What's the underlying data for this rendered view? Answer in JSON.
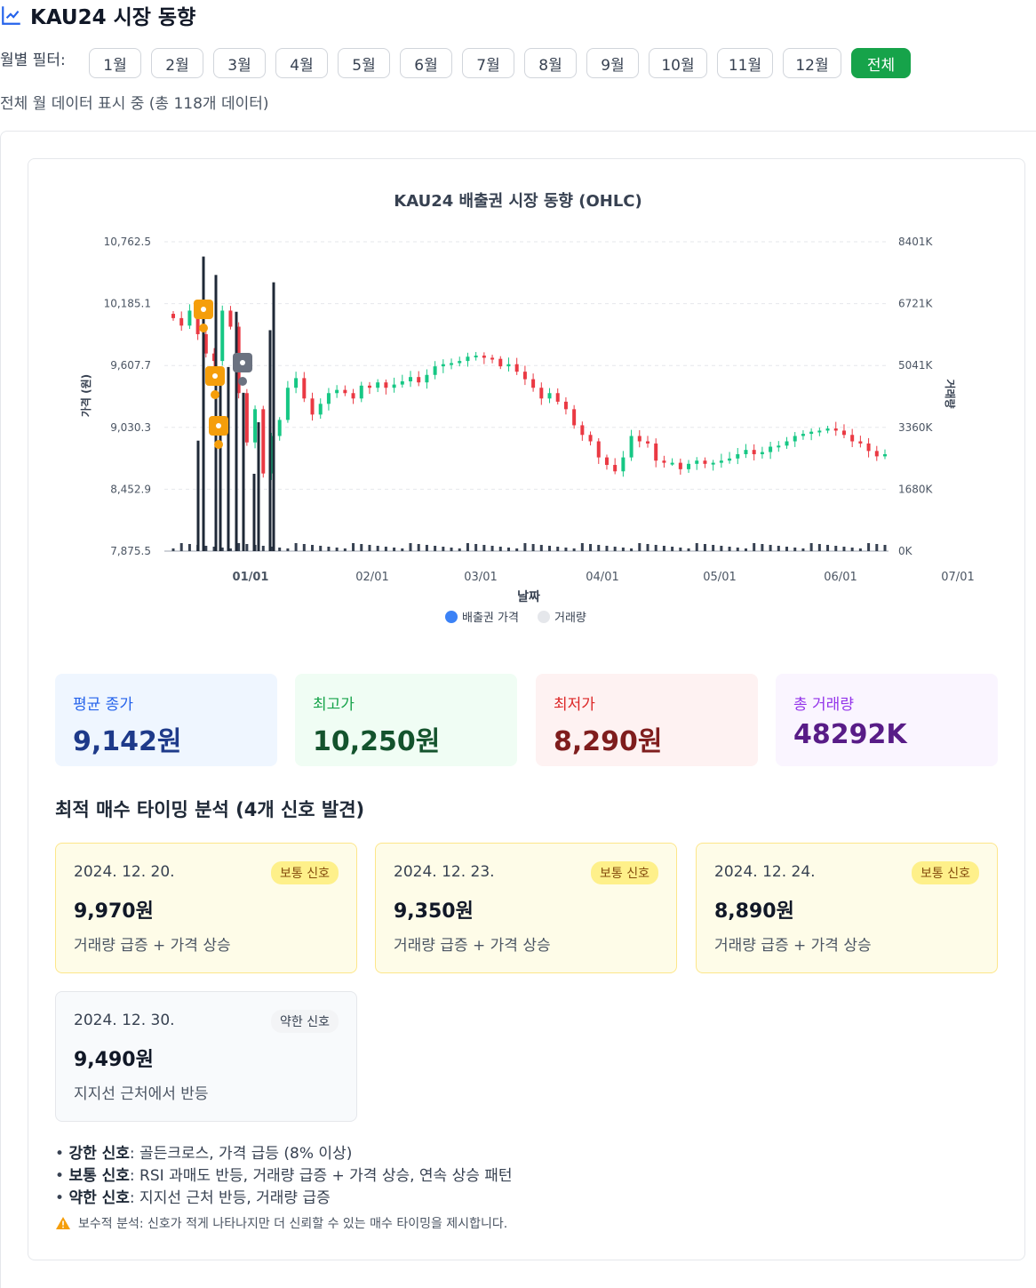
{
  "header": {
    "title": "KAU24 시장 동향",
    "icon": "trend-line-icon"
  },
  "filter": {
    "label": "월별 필터:",
    "months": [
      "1월",
      "2월",
      "3월",
      "4월",
      "5월",
      "6월",
      "7월",
      "8월",
      "9월",
      "10월",
      "11월",
      "12월"
    ],
    "all_label": "전체",
    "selected": "전체",
    "status": "전체 월 데이터 표시 중 (총 118개 데이터)"
  },
  "chart": {
    "title": "KAU24 배출권 시장 동향 (OHLC)",
    "y_left_label": "가격 (원)",
    "y_right_label": "거래량",
    "x_label": "날짜",
    "legend": [
      {
        "label": "배출권 가격",
        "color": "#3b82f6"
      },
      {
        "label": "거래량",
        "color": "#e5e7eb"
      }
    ],
    "y_ticks": [
      "10,762.5",
      "10,185.1",
      "9,607.7",
      "9,030.3",
      "8,452.9",
      "7,875.5"
    ],
    "vol_ticks": [
      "8401K",
      "6721K",
      "5041K",
      "3360K",
      "1680K",
      "0K"
    ],
    "x_ticks": [
      "01/01",
      "02/01",
      "03/01",
      "04/01",
      "05/01",
      "06/01",
      "07/01"
    ],
    "up_color": "#16c784",
    "down_color": "#ea3943"
  },
  "chart_data": {
    "type": "candlestick",
    "y_range": [
      7875.5,
      10762.5
    ],
    "volume_range_k": [
      0,
      8401
    ],
    "x_range": [
      "2024-12-10",
      "2025-07-01"
    ],
    "price_series_abbrev": "approximate daily closes sampled from chart",
    "closes": [
      10050,
      9980,
      10120,
      9900,
      9720,
      9650,
      10120,
      9970,
      9350,
      8890,
      9200,
      8600,
      8950,
      9100,
      9400,
      9490,
      9300,
      9150,
      9250,
      9350,
      9380,
      9350,
      9300,
      9420,
      9400,
      9450,
      9400,
      9430,
      9460,
      9500,
      9450,
      9520,
      9600,
      9620,
      9630,
      9650,
      9690,
      9700,
      9680,
      9670,
      9600,
      9620,
      9550,
      9480,
      9400,
      9300,
      9350,
      9270,
      9200,
      9050,
      8960,
      8900,
      8750,
      8680,
      8620,
      8750,
      8950,
      8900,
      8880,
      8720,
      8700,
      8700,
      8640,
      8690,
      8720,
      8690,
      8700,
      8720,
      8740,
      8780,
      8820,
      8780,
      8800,
      8850,
      8860,
      8900,
      8950,
      8970,
      8990,
      9000,
      9020,
      9000,
      8960,
      8900,
      8880,
      8810,
      8760,
      8780
    ],
    "markers": [
      {
        "date": "2024. 12. 20.",
        "price": 9970,
        "strength": "보통"
      },
      {
        "date": "2024. 12. 23.",
        "price": 9350,
        "strength": "보통"
      },
      {
        "date": "2024. 12. 24.",
        "price": 8890,
        "strength": "보통"
      },
      {
        "date": "2024. 12. 30.",
        "price": 9490,
        "strength": "약한"
      }
    ],
    "big_volumes_k": [
      3000,
      8000,
      7500,
      4500,
      5000,
      6500,
      4300,
      2100,
      3500,
      6000,
      7300
    ]
  },
  "stats": [
    {
      "label": "평균 종가",
      "value": "9,142원",
      "bg": "#eff6ff",
      "lbl_color": "#2563eb",
      "val_color": "#1e3a8a"
    },
    {
      "label": "최고가",
      "value": "10,250원",
      "bg": "#f0fdf4",
      "lbl_color": "#16a34a",
      "val_color": "#14532d"
    },
    {
      "label": "최저가",
      "value": "8,290원",
      "bg": "#fef2f2",
      "lbl_color": "#dc2626",
      "val_color": "#7f1d1d"
    },
    {
      "label": "총 거래량",
      "value": "48292K",
      "bg": "#faf5ff",
      "lbl_color": "#9333ea",
      "val_color": "#581c87"
    }
  ],
  "analysis": {
    "title": "최적 매수 타이밍 분석 (4개 신호 발견)",
    "signals": [
      {
        "date": "2024. 12. 20.",
        "badge": "보통 신호",
        "price": "9,970원",
        "desc": "거래량 급증 + 가격 상승"
      },
      {
        "date": "2024. 12. 23.",
        "badge": "보통 신호",
        "price": "9,350원",
        "desc": "거래량 급증 + 가격 상승"
      },
      {
        "date": "2024. 12. 24.",
        "badge": "보통 신호",
        "price": "8,890원",
        "desc": "거래량 급증 + 가격 상승"
      },
      {
        "date": "2024. 12. 30.",
        "badge": "약한 신호",
        "price": "9,490원",
        "desc": "지지선 근처에서 반등"
      }
    ],
    "legend": [
      {
        "name": "강한 신호",
        "text": ": 골든크로스, 가격 급등 (8% 이상)"
      },
      {
        "name": "보통 신호",
        "text": ": RSI 과매도 반등, 거래량 급증 + 가격 상승, 연속 상승 패턴"
      },
      {
        "name": "약한 신호",
        "text": ": 지지선 근처 반등, 거래량 급증"
      }
    ],
    "note": "보수적 분석: 신호가 적게 나타나지만 더 신뢰할 수 있는 매수 타이밍을 제시합니다.",
    "note_icon": "warning-icon"
  }
}
